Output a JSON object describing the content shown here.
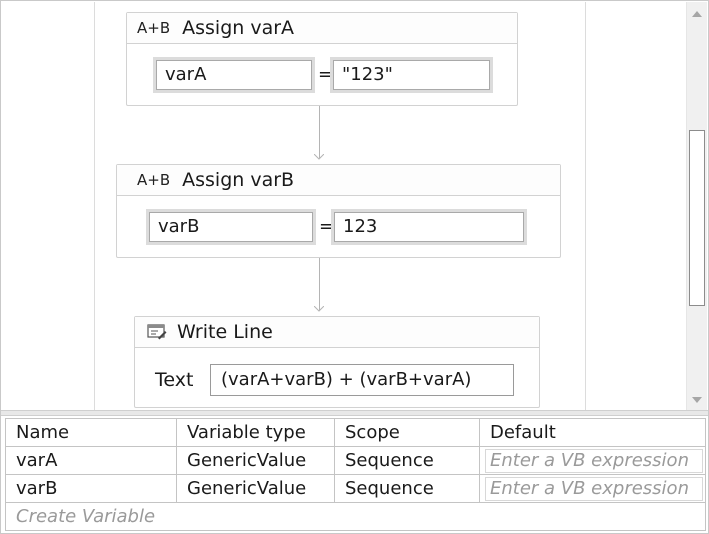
{
  "designer": {
    "assign_a": {
      "icon": "A+B",
      "title": "Assign varA",
      "to": "varA",
      "operator": "=",
      "value": "\"123\""
    },
    "assign_b": {
      "icon": "A+B",
      "title": "Assign varB",
      "to": "varB",
      "operator": "=",
      "value": "123"
    },
    "write_line": {
      "icon": "write-line-icon",
      "title": "Write Line",
      "text_label": "Text",
      "text_value": "(varA+varB) + (varB+varA)"
    }
  },
  "variables": {
    "headers": [
      "Name",
      "Variable type",
      "Scope",
      "Default"
    ],
    "rows": [
      {
        "name": "varA",
        "type": "GenericValue",
        "scope": "Sequence",
        "default_placeholder": "Enter a VB expression"
      },
      {
        "name": "varB",
        "type": "GenericValue",
        "scope": "Sequence",
        "default_placeholder": "Enter a VB expression"
      }
    ],
    "create_label": "Create Variable"
  }
}
